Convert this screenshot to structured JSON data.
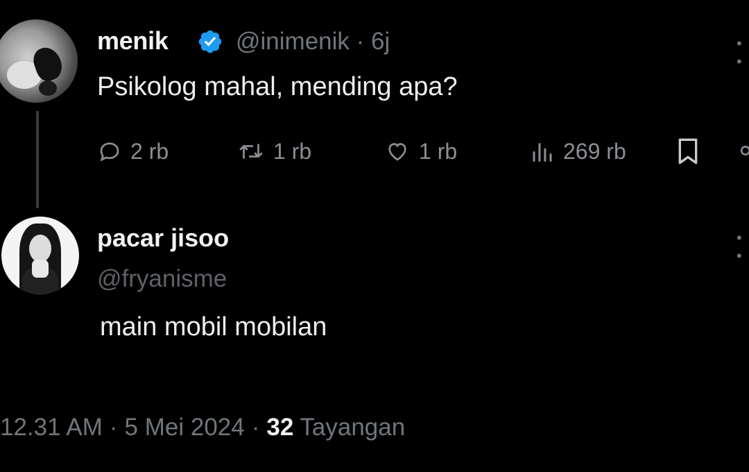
{
  "tweet": {
    "author": {
      "name": "menik",
      "handle": "@inimenik",
      "time": "· 6j",
      "verified": true,
      "avatar_icon": "avatar-icon"
    },
    "text": "Psikolog mahal, mending apa?",
    "more_icon": "more-options-icon",
    "actions": {
      "reply": {
        "icon": "reply-icon",
        "count": "2 rb"
      },
      "retweet": {
        "icon": "retweet-icon",
        "count": "1 rb"
      },
      "like": {
        "icon": "heart-icon",
        "count": "1 rb"
      },
      "views": {
        "icon": "views-icon",
        "count": "269 rb"
      },
      "bookmark": {
        "icon": "bookmark-icon"
      },
      "share": {
        "icon": "share-icon"
      }
    }
  },
  "reply": {
    "author": {
      "name": "pacar jisoo",
      "handle": "@fryanisme",
      "avatar_icon": "avatar-icon"
    },
    "text": "main mobil mobilan",
    "more_icon": "more-options-icon",
    "footer": {
      "time": "12.31 AM",
      "date": "5 Mei 2024",
      "views_count": "32",
      "views_label": "Tayangan"
    }
  },
  "colors": {
    "background": "#000000",
    "text": "#e7e9ea",
    "secondary": "#71767b",
    "verified_blue": "#1d9bf0"
  }
}
